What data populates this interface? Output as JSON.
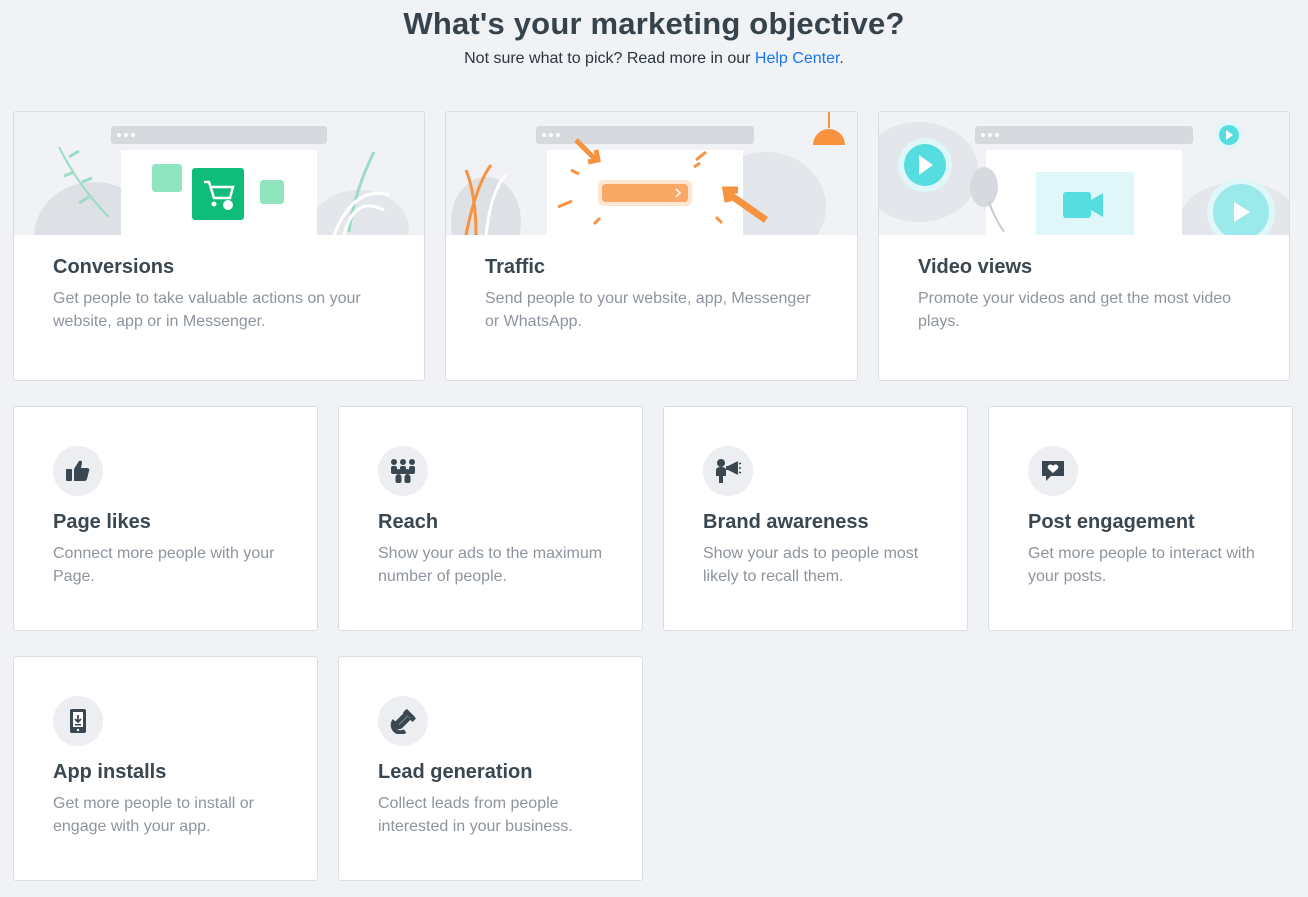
{
  "header": {
    "title": "What's your marketing objective?",
    "subtitle_prefix": "Not sure what to pick? Read more in our ",
    "help_link": "Help Center",
    "subtitle_suffix": "."
  },
  "colors": {
    "accent_green": "#0fbc7a",
    "accent_orange": "#f7923e",
    "accent_cyan": "#55dde0",
    "link": "#1877f2"
  },
  "objectives": [
    {
      "title": "Conversions",
      "description": "Get people to take valuable actions on your website, app or in Messenger.",
      "icon": "shopping-cart-illustration"
    },
    {
      "title": "Traffic",
      "description": "Send people to your website, app, Messenger or WhatsApp.",
      "icon": "click-arrow-illustration"
    },
    {
      "title": "Video views",
      "description": "Promote your videos and get the most video plays.",
      "icon": "video-camera-illustration"
    },
    {
      "title": "Page likes",
      "description": "Connect more people with your Page.",
      "icon": "thumbs-up-icon"
    },
    {
      "title": "Reach",
      "description": "Show your ads to the maximum number of people.",
      "icon": "people-group-icon"
    },
    {
      "title": "Brand awareness",
      "description": "Show your ads to people most likely to recall them.",
      "icon": "megaphone-person-icon"
    },
    {
      "title": "Post engagement",
      "description": "Get more people to interact with your posts.",
      "icon": "heart-bubble-icon"
    },
    {
      "title": "App installs",
      "description": "Get more people to install or engage with your app.",
      "icon": "phone-download-icon"
    },
    {
      "title": "Lead generation",
      "description": "Collect leads from people interested in your business.",
      "icon": "magnet-icon"
    }
  ]
}
